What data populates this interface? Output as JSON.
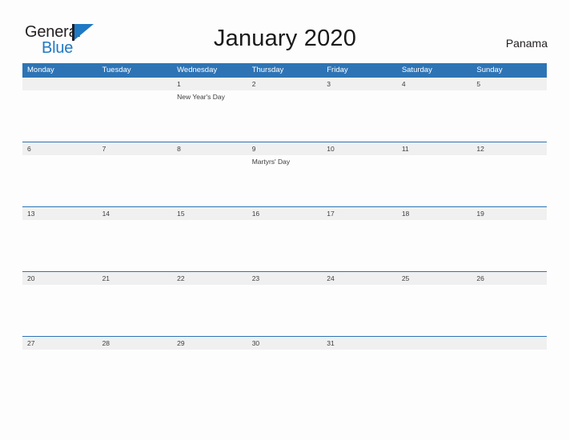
{
  "brand": {
    "logo_text_top": "General",
    "logo_text_bottom": "Blue",
    "logo_icon": "flag-triangle-icon",
    "accent_color": "#1f79c4"
  },
  "header": {
    "title": "January 2020",
    "region": "Panama",
    "header_bg_color": "#2e74b5"
  },
  "calendar": {
    "weekdays": [
      "Monday",
      "Tuesday",
      "Wednesday",
      "Thursday",
      "Friday",
      "Saturday",
      "Sunday"
    ],
    "weeks": [
      [
        {
          "day": "",
          "event": ""
        },
        {
          "day": "",
          "event": ""
        },
        {
          "day": "1",
          "event": "New Year's Day"
        },
        {
          "day": "2",
          "event": ""
        },
        {
          "day": "3",
          "event": ""
        },
        {
          "day": "4",
          "event": ""
        },
        {
          "day": "5",
          "event": ""
        }
      ],
      [
        {
          "day": "6",
          "event": ""
        },
        {
          "day": "7",
          "event": ""
        },
        {
          "day": "8",
          "event": ""
        },
        {
          "day": "9",
          "event": "Martyrs' Day"
        },
        {
          "day": "10",
          "event": ""
        },
        {
          "day": "11",
          "event": ""
        },
        {
          "day": "12",
          "event": ""
        }
      ],
      [
        {
          "day": "13",
          "event": ""
        },
        {
          "day": "14",
          "event": ""
        },
        {
          "day": "15",
          "event": ""
        },
        {
          "day": "16",
          "event": ""
        },
        {
          "day": "17",
          "event": ""
        },
        {
          "day": "18",
          "event": ""
        },
        {
          "day": "19",
          "event": ""
        }
      ],
      [
        {
          "day": "20",
          "event": ""
        },
        {
          "day": "21",
          "event": ""
        },
        {
          "day": "22",
          "event": ""
        },
        {
          "day": "23",
          "event": ""
        },
        {
          "day": "24",
          "event": ""
        },
        {
          "day": "25",
          "event": ""
        },
        {
          "day": "26",
          "event": ""
        }
      ],
      [
        {
          "day": "27",
          "event": ""
        },
        {
          "day": "28",
          "event": ""
        },
        {
          "day": "29",
          "event": ""
        },
        {
          "day": "30",
          "event": ""
        },
        {
          "day": "31",
          "event": ""
        },
        {
          "day": "",
          "event": ""
        },
        {
          "day": "",
          "event": ""
        }
      ]
    ]
  }
}
